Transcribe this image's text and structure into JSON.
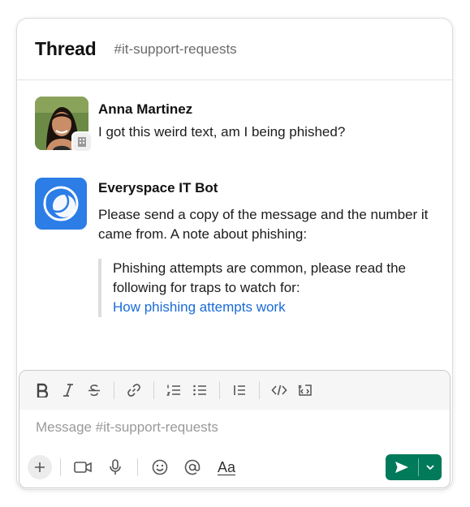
{
  "header": {
    "title": "Thread",
    "channel": "#it-support-requests"
  },
  "messages": [
    {
      "sender": "Anna Martinez",
      "text": "I got this weird text, am I being phished?",
      "avatar": "user-photo",
      "badge_icon": "building-icon"
    },
    {
      "sender": "Everyspace IT Bot",
      "text": "Please send a copy of the message and the number it came from. A note about phishing:",
      "avatar": "bot-logo",
      "quote": {
        "text": "Phishing attempts are common, please read the following for traps to watch for:",
        "link": "How phishing attempts work"
      }
    }
  ],
  "composer": {
    "placeholder": "Message #it-support-requests",
    "value": "",
    "format_tools": [
      "bold-icon",
      "italic-icon",
      "strikethrough-icon",
      "link-icon",
      "ordered-list-icon",
      "bullet-list-icon",
      "blockquote-icon",
      "code-icon",
      "code-block-icon"
    ],
    "bottom_tools": [
      "plus-icon",
      "video-icon",
      "microphone-icon",
      "emoji-icon",
      "mention-icon",
      "text-format-icon"
    ],
    "format_label": "Aa"
  },
  "colors": {
    "send": "#007a5a",
    "link": "#1a6bd8",
    "bot_avatar": "#2c7de6"
  }
}
